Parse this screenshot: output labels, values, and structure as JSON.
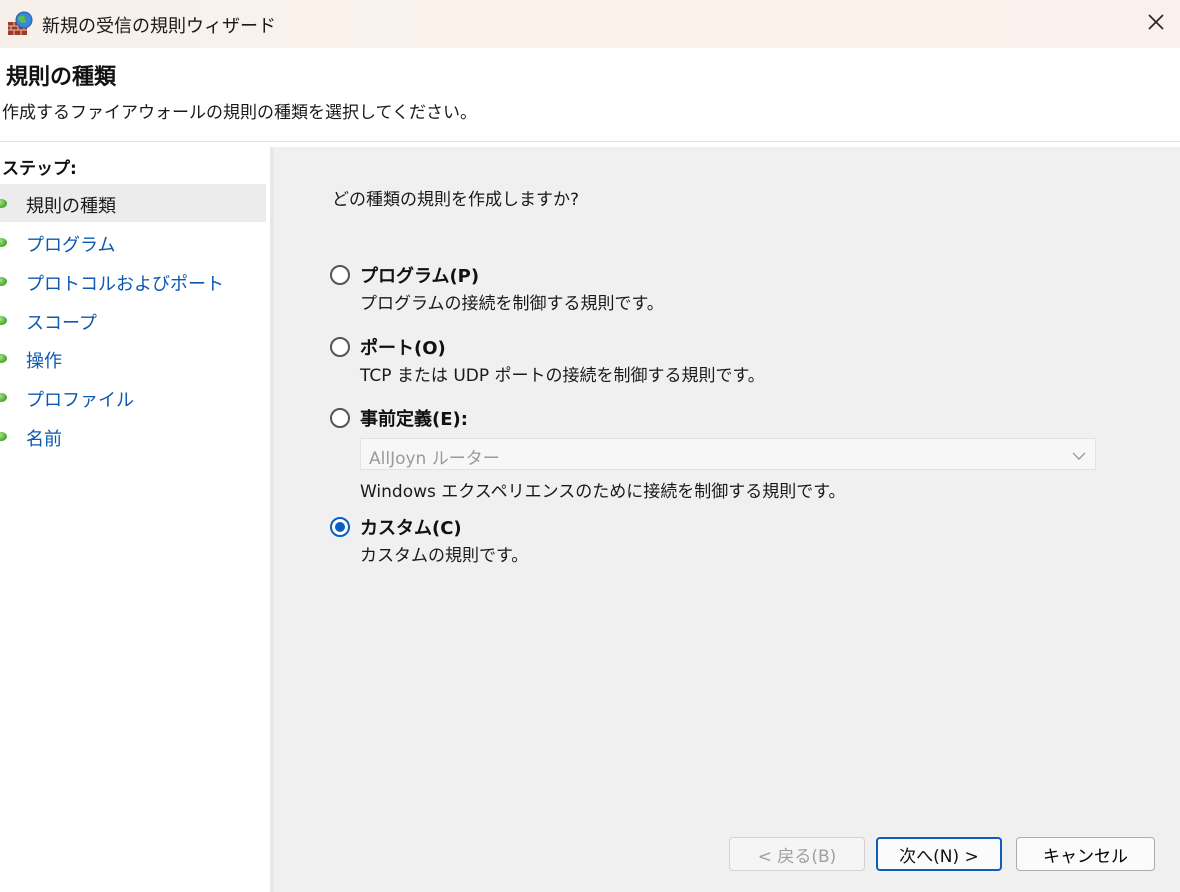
{
  "window": {
    "title": "新規の受信の規則ウィザード",
    "close_icon": "close-icon"
  },
  "header": {
    "title": "規則の種類",
    "description": "作成するファイアウォールの規則の種類を選択してください。"
  },
  "sidebar": {
    "steps_label": "ステップ:",
    "items": [
      {
        "label": "規則の種類",
        "active": true
      },
      {
        "label": "プログラム",
        "active": false
      },
      {
        "label": "プロトコルおよびポート",
        "active": false
      },
      {
        "label": "スコープ",
        "active": false
      },
      {
        "label": "操作",
        "active": false
      },
      {
        "label": "プロファイル",
        "active": false
      },
      {
        "label": "名前",
        "active": false
      }
    ]
  },
  "main": {
    "question": "どの種類の規則を作成しますか?",
    "options": [
      {
        "title": "プログラム(P)",
        "description": "プログラムの接続を制御する規則です。",
        "checked": false
      },
      {
        "title": "ポート(O)",
        "description": "TCP または UDP ポートの接続を制御する規則です。",
        "checked": false
      },
      {
        "title": "事前定義(E):",
        "description": "Windows エクスペリエンスのために接続を制御する規則です。",
        "checked": false
      },
      {
        "title": "カスタム(C)",
        "description": "カスタムの規則です。",
        "checked": true
      }
    ],
    "predefined_select": {
      "value": "AllJoyn ルーター"
    }
  },
  "buttons": {
    "back": "< 戻る(B)",
    "next": "次へ(N) >",
    "cancel": "キャンセル"
  },
  "colors": {
    "accent": "#0a5fc0",
    "link": "#0d58b0",
    "step_dot": "#4fae33"
  }
}
